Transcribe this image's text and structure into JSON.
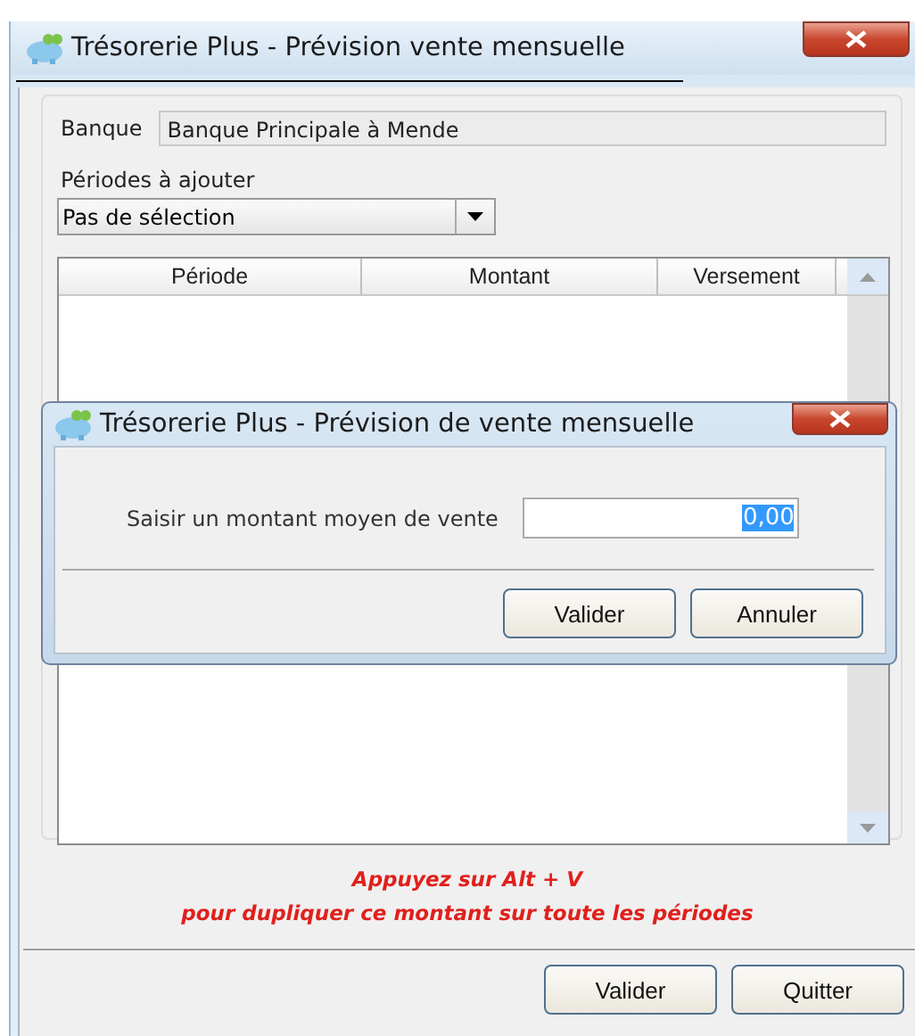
{
  "window": {
    "title": "Trésorerie Plus - Prévision vente mensuelle"
  },
  "bank": {
    "label": "Banque",
    "value": "Banque Principale à Mende"
  },
  "periods": {
    "label": "Périodes à ajouter",
    "value": "Pas de sélection"
  },
  "table": {
    "columns": [
      "Période",
      "Montant",
      "Versement"
    ]
  },
  "dialog": {
    "title": "Trésorerie Plus - Prévision de vente mensuelle",
    "prompt": "Saisir un montant moyen de vente",
    "amount": "0,00",
    "amount_selected": true,
    "buttons": [
      "Valider",
      "Annuler"
    ]
  },
  "hint": [
    "Appuyez sur Alt + V",
    "pour dupliquer ce montant sur toute les périodes"
  ],
  "buttons": [
    "Valider",
    "Quitter"
  ]
}
